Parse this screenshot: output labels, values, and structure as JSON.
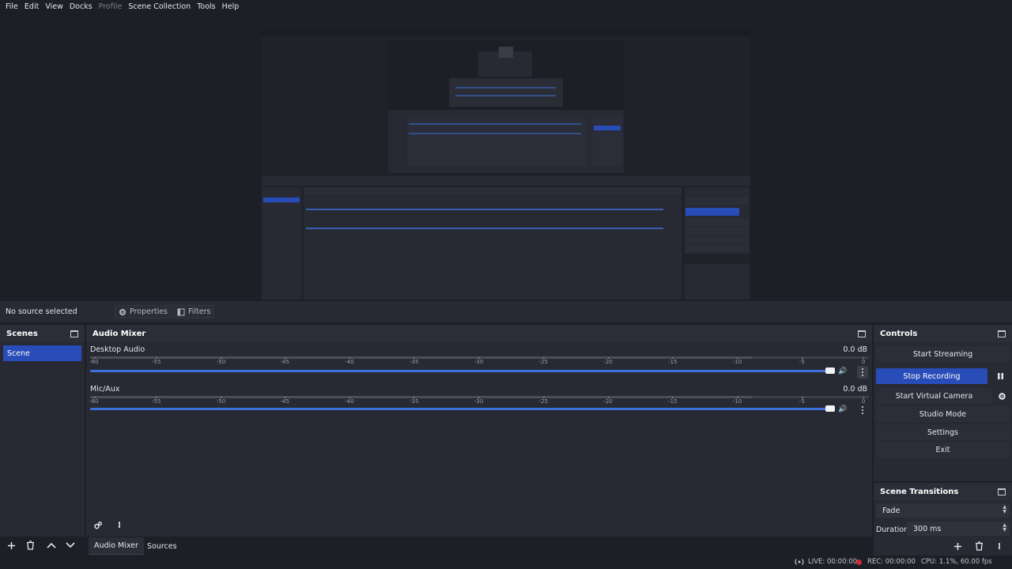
{
  "menu": [
    "File",
    "Edit",
    "View",
    "Docks",
    "Profile",
    "Scene Collection",
    "Tools",
    "Help"
  ],
  "menu_disabled": [
    "Profile"
  ],
  "sourcebar": {
    "no_source": "No source selected",
    "properties": "Properties",
    "filters": "Filters"
  },
  "scenes": {
    "title": "Scenes",
    "items": [
      "Scene"
    ]
  },
  "mixer": {
    "title": "Audio Mixer",
    "ticks": [
      "-60",
      "-55",
      "-50",
      "-45",
      "-40",
      "-35",
      "-30",
      "-25",
      "-20",
      "-15",
      "-10",
      "-5",
      "0"
    ],
    "channels": [
      {
        "name": "Desktop Audio",
        "db": "0.0 dB"
      },
      {
        "name": "Mic/Aux",
        "db": "0.0 dB"
      }
    ]
  },
  "controls": {
    "title": "Controls",
    "start_streaming": "Start Streaming",
    "stop_recording": "Stop Recording",
    "start_virtual_camera": "Start Virtual Camera",
    "studio_mode": "Studio Mode",
    "settings": "Settings",
    "exit": "Exit"
  },
  "transitions": {
    "title": "Scene Transitions",
    "selected": "Fade",
    "duration_label": "Duration",
    "duration_value": "300 ms"
  },
  "tabs": {
    "audio_mixer": "Audio Mixer",
    "sources": "Sources"
  },
  "status": {
    "live": "LIVE: 00:00:00",
    "rec": "REC: 00:00:00",
    "cpu": "CPU: 1.1%, 60.00 fps"
  },
  "colors": {
    "accent": "#284cb8",
    "slider": "#3f6fdb",
    "mute": "#d02a3a",
    "rec_dot": "#d02a3a"
  }
}
